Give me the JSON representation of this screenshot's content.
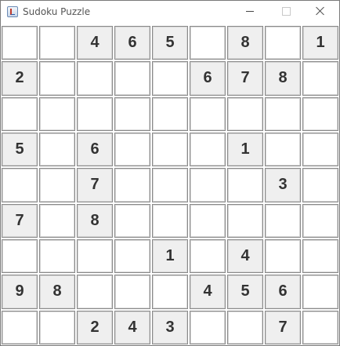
{
  "window": {
    "title": "Sudoku Puzzle",
    "icon": "java-app-icon",
    "controls": [
      "minimize-icon",
      "maximize-icon",
      "close-icon"
    ]
  },
  "colors": {
    "given_cell_bg": "#efefef",
    "empty_cell_bg": "#ffffff",
    "digit": "#333333"
  },
  "board": {
    "rows": [
      [
        "",
        "",
        "4",
        "6",
        "5",
        "",
        "8",
        "",
        "1"
      ],
      [
        "2",
        "",
        "",
        "",
        "",
        "6",
        "7",
        "8",
        ""
      ],
      [
        "",
        "",
        "",
        "",
        "",
        "",
        "",
        "",
        ""
      ],
      [
        "5",
        "",
        "6",
        "",
        "",
        "",
        "1",
        "",
        ""
      ],
      [
        "",
        "",
        "7",
        "",
        "",
        "",
        "",
        "3",
        ""
      ],
      [
        "7",
        "",
        "8",
        "",
        "",
        "",
        "",
        "",
        ""
      ],
      [
        "",
        "",
        "",
        "",
        "1",
        "",
        "4",
        "",
        ""
      ],
      [
        "9",
        "8",
        "",
        "",
        "",
        "4",
        "5",
        "6",
        ""
      ],
      [
        "",
        "",
        "2",
        "4",
        "3",
        "",
        "",
        "7",
        ""
      ]
    ]
  }
}
